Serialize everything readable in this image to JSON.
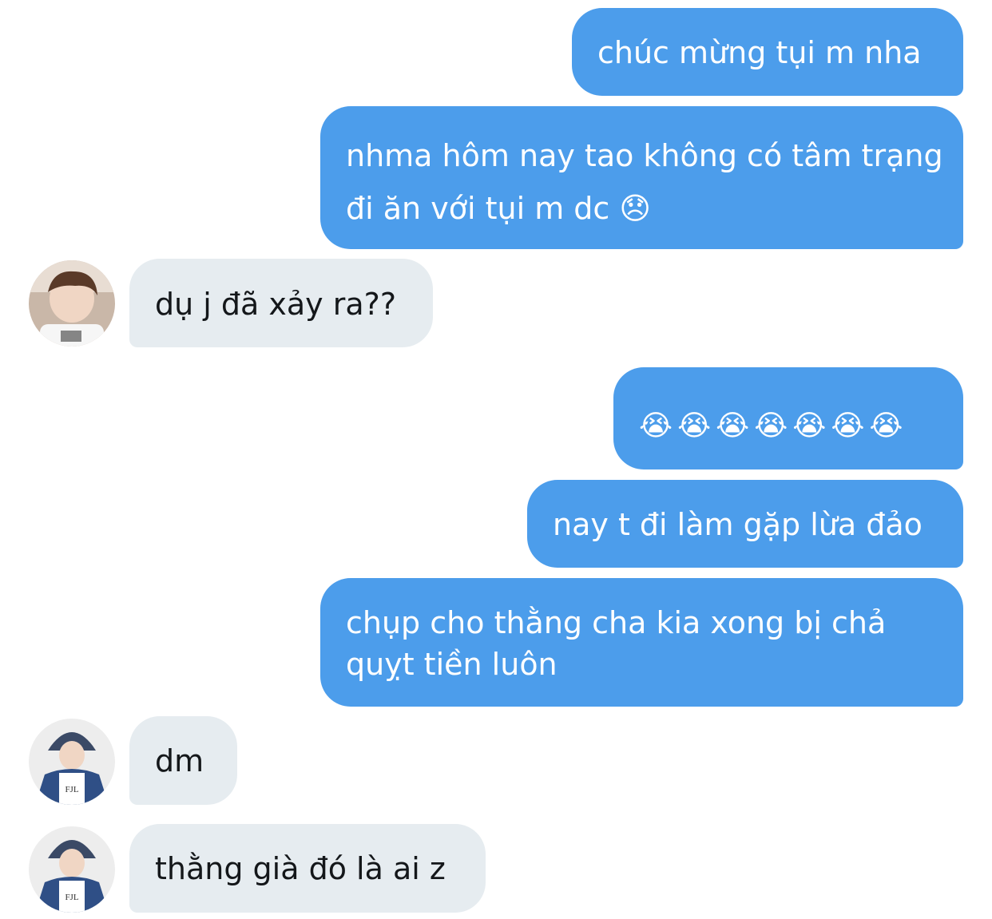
{
  "conversation": {
    "messages": [
      {
        "sender": "self",
        "text": "chúc mừng tụi m nha"
      },
      {
        "sender": "self",
        "text": "nhma hôm nay tao không có tâm trạng đi ăn với tụi m dc 😞"
      },
      {
        "sender": "other",
        "text": "dụ j đã xảy ra??"
      },
      {
        "sender": "self",
        "text": "😭😭😭😭😭😭😭"
      },
      {
        "sender": "self",
        "text": "nay t đi làm gặp lừa đảo"
      },
      {
        "sender": "self",
        "text": "chụp cho thằng cha kia xong bị chả quỵt tiền luôn"
      },
      {
        "sender": "other",
        "text": "dm"
      },
      {
        "sender": "other",
        "text": "thằng già đó là ai z"
      }
    ]
  },
  "avatar_print_text": "FJL",
  "colors": {
    "outgoing_bubble": "#4c9deb",
    "incoming_bubble": "#e6ecf0",
    "outgoing_text": "#ffffff",
    "incoming_text": "#14171a"
  }
}
